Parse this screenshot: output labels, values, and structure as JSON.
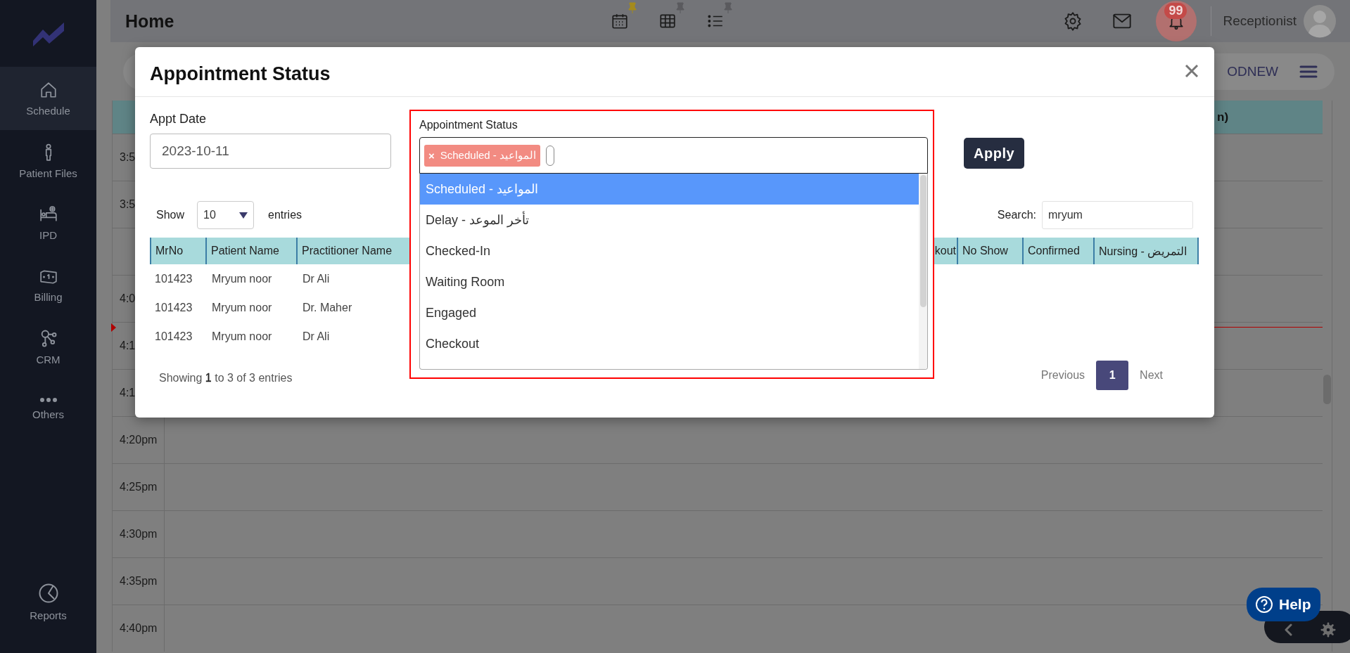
{
  "sidebar": {
    "items": [
      {
        "label": "Schedule",
        "selected": true
      },
      {
        "label": "Patient Files",
        "selected": false
      },
      {
        "label": "IPD",
        "selected": false
      },
      {
        "label": "Billing",
        "selected": false
      },
      {
        "label": "CRM",
        "selected": false
      },
      {
        "label": "Others",
        "selected": false
      }
    ],
    "bottom_item": {
      "label": "Reports"
    }
  },
  "header": {
    "title": "Home",
    "view_icons": [
      {
        "pinned": true
      },
      {
        "pinned": false
      },
      {
        "pinned": false
      }
    ],
    "notification_count": "99",
    "user": "Receptionist"
  },
  "toolbar": {
    "label": "ODNEW"
  },
  "calendar": {
    "column_header": "n)",
    "rows": [
      {
        "time": "3:5",
        "now": false
      },
      {
        "time": "3:5",
        "now": false
      },
      {
        "now": false
      },
      {
        "time": "4:0",
        "now": false
      },
      {
        "time": "4:1",
        "now": true
      },
      {
        "time": "4:1",
        "now": false
      },
      {
        "time": "4:20pm",
        "now": false
      },
      {
        "time": "4:25pm",
        "now": false
      },
      {
        "time": "4:30pm",
        "now": false
      },
      {
        "time": "4:35pm",
        "now": false
      },
      {
        "time": "4:40pm",
        "now": false
      }
    ]
  },
  "modal": {
    "title": "Appointment Status",
    "appt_date": {
      "label": "Appt Date",
      "value": "2023-10-11"
    },
    "status_filter": {
      "label": "Appointment Status",
      "chips": [
        {
          "remove": "×",
          "label": "Scheduled - المواعيد"
        }
      ],
      "options": [
        {
          "label": "Scheduled - المواعيد",
          "selected": true
        },
        {
          "label": "Delay - تأخر الموعد",
          "selected": false
        },
        {
          "label": "Checked-In",
          "selected": false
        },
        {
          "label": "Waiting Room",
          "selected": false
        },
        {
          "label": "Engaged",
          "selected": false
        },
        {
          "label": "Checkout",
          "selected": false
        }
      ]
    },
    "apply_button": "Apply",
    "length": {
      "before": "Show",
      "value": "10",
      "after": "entries"
    },
    "search": {
      "label": "Search:",
      "value": "mryum"
    },
    "table": {
      "columns_left": [
        "MrNo",
        "Patient Name",
        "Practitioner Name"
      ],
      "columns_right": [
        "kout",
        "No Show",
        "Confirmed",
        "Nursing - التمريض"
      ],
      "rows": [
        [
          "101423",
          "Mryum noor",
          "Dr Ali"
        ],
        [
          "101423",
          "Mryum noor",
          "Dr. Maher"
        ],
        [
          "101423",
          "Mryum noor",
          "Dr Ali"
        ]
      ]
    },
    "info": "Showing **1** to 3 of 3 entries",
    "pagination": {
      "previous": "Previous",
      "pages": [
        {
          "label": "1",
          "selected": true
        }
      ],
      "next": "Next"
    }
  },
  "help_button": "Help"
}
